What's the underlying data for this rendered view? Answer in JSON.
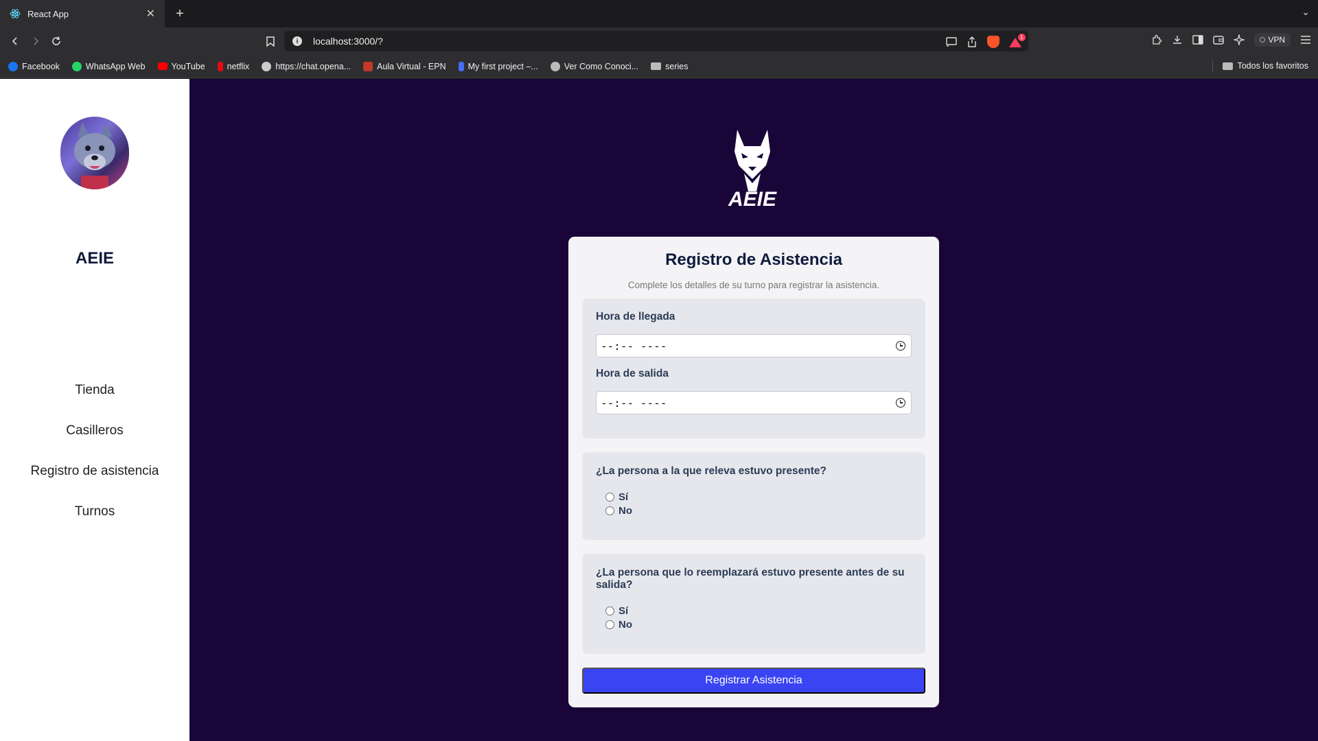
{
  "browser": {
    "tab_title": "React App",
    "url": "localhost:3000/?",
    "vpn_label": "VPN",
    "shields_badge": "1",
    "bookmarks": [
      {
        "label": "Facebook",
        "color": "#1877f2"
      },
      {
        "label": "WhatsApp Web",
        "color": "#25d366"
      },
      {
        "label": "YouTube",
        "color": "#ff0000"
      },
      {
        "label": "netflix",
        "color": "#e50914"
      },
      {
        "label": "https://chat.opena...",
        "color": "#cccccc"
      },
      {
        "label": "Aula Virtual - EPN",
        "color": "#c0392b"
      },
      {
        "label": "My first project –...",
        "color": "#4a6cf7"
      },
      {
        "label": "Ver Como Conoci...",
        "color": "#bbbbbb"
      },
      {
        "label": "series",
        "color": "#bbbbbb"
      }
    ],
    "all_bookmarks_label": "Todos los favoritos"
  },
  "sidebar": {
    "brand": "AEIE",
    "nav": [
      {
        "label": "Tienda"
      },
      {
        "label": "Casilleros"
      },
      {
        "label": "Registro de asistencia"
      },
      {
        "label": "Turnos"
      }
    ]
  },
  "form": {
    "title": "Registro de Asistencia",
    "subtitle": "Complete los detalles de su turno para registrar la asistencia.",
    "arrival_label": "Hora de llegada",
    "arrival_value": "--:-- ----",
    "departure_label": "Hora de salida",
    "departure_value": "--:-- ----",
    "q1": {
      "question": "¿La persona a la que releva estuvo presente?",
      "yes": "Sí",
      "no": "No"
    },
    "q2": {
      "question": "¿La persona que lo reemplazará estuvo presente antes de su salida?",
      "yes": "Sí",
      "no": "No"
    },
    "submit_label": "Registrar Asistencia"
  },
  "colors": {
    "page_background": "#1a0538",
    "card_background": "#f4f4f6",
    "button": "#3a44f2"
  }
}
